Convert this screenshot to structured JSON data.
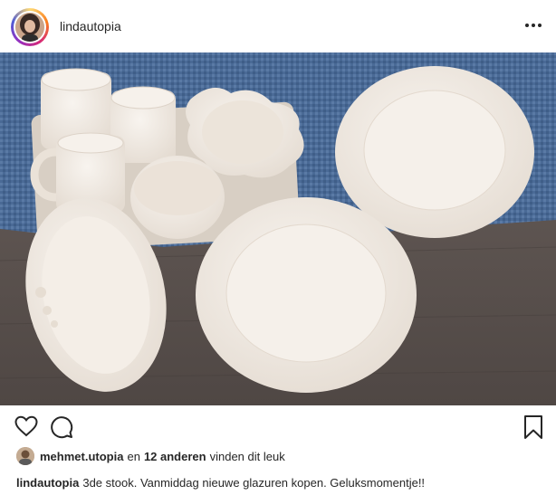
{
  "post": {
    "username": "lindautopia",
    "more_icon": "more-horizontal-icon",
    "actions": {
      "like_icon": "heart-icon",
      "comment_icon": "comment-icon",
      "save_icon": "bookmark-icon"
    },
    "likes": {
      "first_liker": "mehmet.utopia",
      "and_text": "en",
      "others": "12 anderen",
      "suffix": "vinden dit leuk"
    },
    "caption": {
      "author": "lindautopia",
      "text": "3de stook. Vanmiddag nieuwe glazuren kopen. Geluksmomentje!!"
    }
  },
  "colors": {
    "text": "#262626",
    "table_wood": "#5f5552",
    "placemat": "#4f6f99",
    "ceramic": "#f3ede6"
  }
}
